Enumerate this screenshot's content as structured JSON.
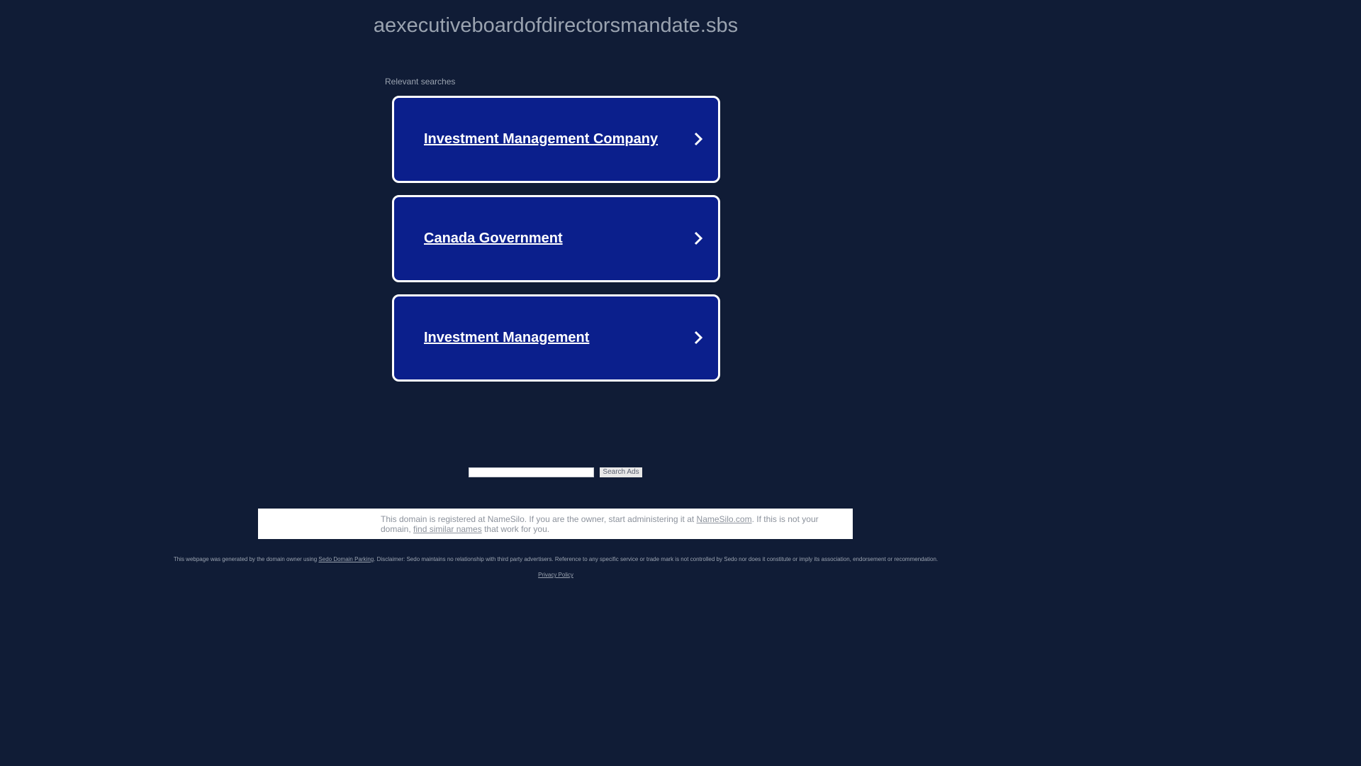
{
  "header": {
    "domain": "aexecutiveboardofdirectorsmandate.sbs"
  },
  "searches": {
    "label": "Relevant searches",
    "items": [
      {
        "label": "Investment Management Company",
        "icon": "chevron-right-icon"
      },
      {
        "label": "Canada Government",
        "icon": "chevron-right-icon"
      },
      {
        "label": "Investment Management",
        "icon": "chevron-right-icon"
      }
    ]
  },
  "search_box": {
    "value": "",
    "button_label": "Search Ads"
  },
  "info": {
    "text_1": "This domain is registered at NameSilo. If you are the owner, start administering it at ",
    "link_1": "NameSilo.com",
    "text_2": ". If this is not your domain, ",
    "link_2": "find similar names",
    "text_3": " that work for you."
  },
  "footer": {
    "disclaimer_1": "This webpage was generated by the domain owner using ",
    "disclaimer_link": "Sedo Domain Parking",
    "disclaimer_2": ". Disclaimer: Sedo maintains no relationship with third party advertisers. Reference to any specific service or trade mark is not controlled by Sedo nor does it constitute or imply its association, endorsement or recommendation.",
    "privacy": "Privacy Policy"
  },
  "colors": {
    "background": "#101c36",
    "card": "#0b1f8c",
    "card_border": "#ffffff"
  }
}
